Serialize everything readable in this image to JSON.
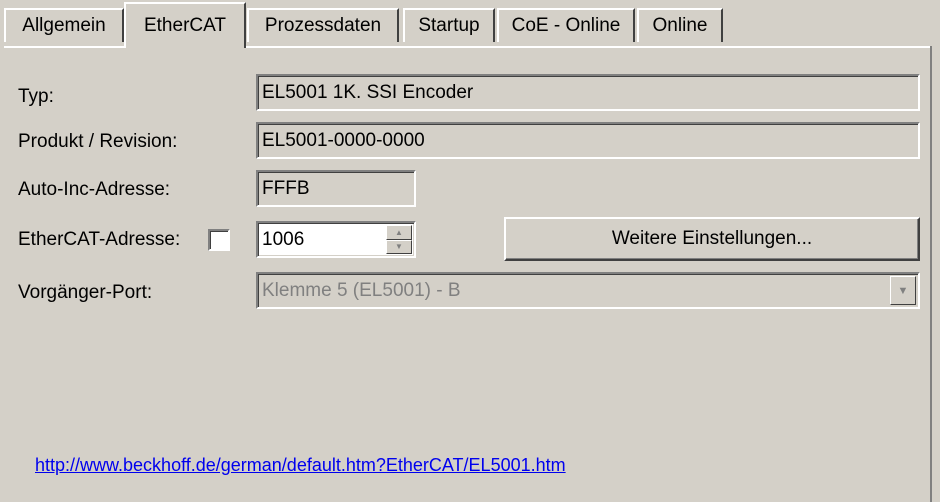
{
  "tabs": [
    {
      "label": "Allgemein",
      "active": false
    },
    {
      "label": "EtherCAT",
      "active": true
    },
    {
      "label": "Prozessdaten",
      "active": false
    },
    {
      "label": "Startup",
      "active": false
    },
    {
      "label": "CoE - Online",
      "active": false
    },
    {
      "label": "Online",
      "active": false
    }
  ],
  "form": {
    "typ_label": "Typ:",
    "typ_value": "EL5001 1K. SSI Encoder",
    "produkt_label": "Produkt / Revision:",
    "produkt_value": "EL5001-0000-0000",
    "autoinc_label": "Auto-Inc-Adresse:",
    "autoinc_value": "FFFB",
    "ethercat_label": "EtherCAT-Adresse:",
    "ethercat_checked": false,
    "ethercat_value": "1006",
    "weitere_button": "Weitere Einstellungen...",
    "vorgaenger_label": "Vorgänger-Port:",
    "vorgaenger_value": "Klemme 5 (EL5001) - B"
  },
  "link": "http://www.beckhoff.de/german/default.htm?EtherCAT/EL5001.htm",
  "colors": {
    "background": "#d4d0c8",
    "link": "#0000ee",
    "disabled_text": "#808080"
  },
  "icons": {
    "spin": "spin-updown-icon",
    "dropdown": "dropdown-arrow-icon"
  }
}
